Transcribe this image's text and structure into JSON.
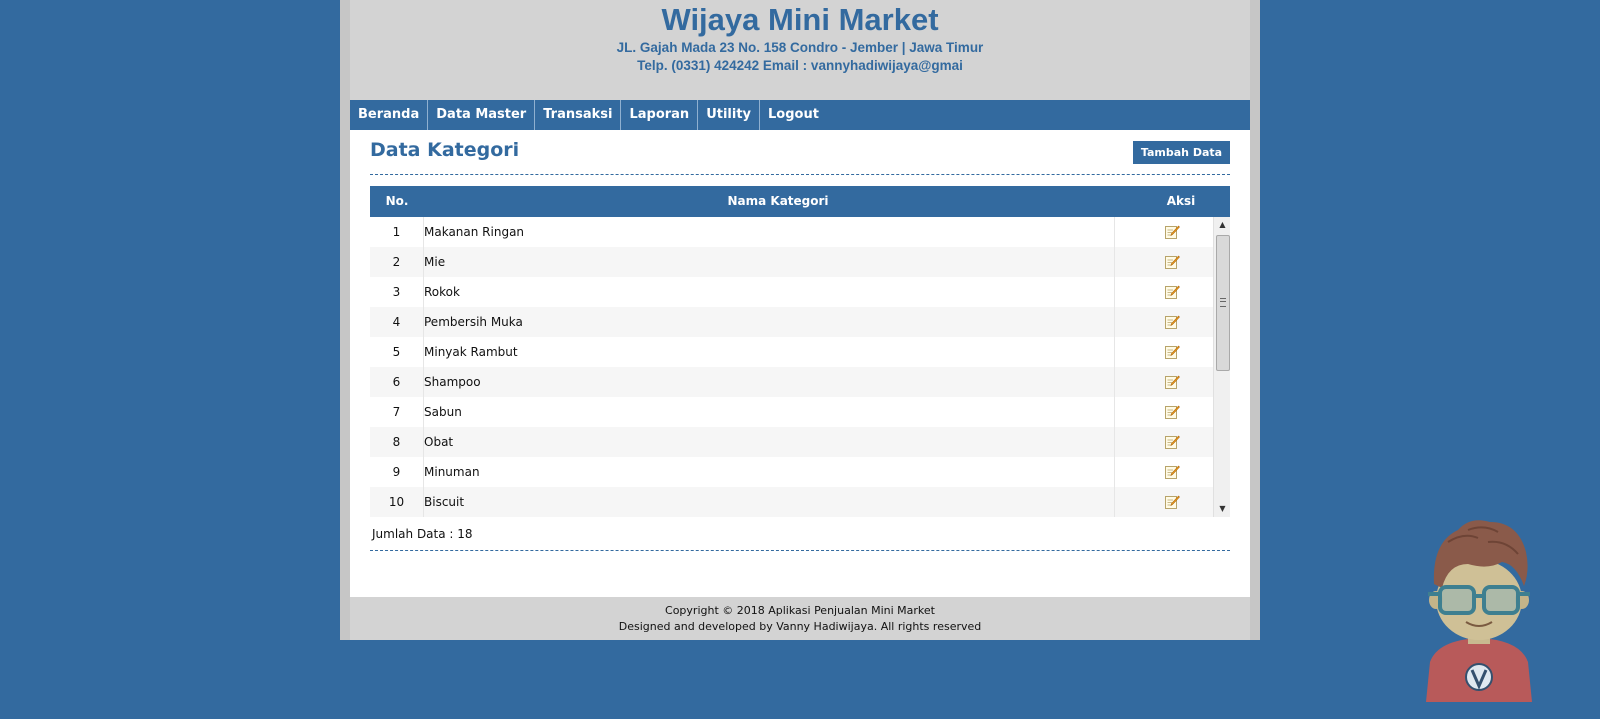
{
  "header": {
    "title": "Wijaya Mini Market",
    "address": "JL. Gajah Mada 23 No. 158 Condro - Jember | Jawa Timur",
    "contact": "Telp. (0331) 424242 Email : vannyhadiwijaya@gmai"
  },
  "nav": {
    "items": [
      {
        "label": "Beranda"
      },
      {
        "label": "Data Master"
      },
      {
        "label": "Transaksi"
      },
      {
        "label": "Laporan"
      },
      {
        "label": "Utility"
      },
      {
        "label": "Logout"
      }
    ]
  },
  "page": {
    "title": "Data Kategori",
    "add_button": "Tambah Data"
  },
  "table": {
    "headers": {
      "no": "No.",
      "name": "Nama Kategori",
      "action": "Aksi"
    },
    "rows": [
      {
        "no": "1",
        "name": "Makanan Ringan"
      },
      {
        "no": "2",
        "name": "Mie"
      },
      {
        "no": "3",
        "name": "Rokok"
      },
      {
        "no": "4",
        "name": "Pembersih Muka"
      },
      {
        "no": "5",
        "name": "Minyak Rambut"
      },
      {
        "no": "6",
        "name": "Shampoo"
      },
      {
        "no": "7",
        "name": "Sabun"
      },
      {
        "no": "8",
        "name": "Obat"
      },
      {
        "no": "9",
        "name": "Minuman"
      },
      {
        "no": "10",
        "name": "Biscuit"
      }
    ],
    "row_action_icon": "edit-icon"
  },
  "summary": {
    "label": "Jumlah Data : 18"
  },
  "footer": {
    "line1": "Copyright © 2018 Aplikasi Penjualan Mini Market",
    "line2": "Designed and developed by Vanny Hadiwijaya. All rights reserved"
  },
  "colors": {
    "background": "#336a9f",
    "accent": "#336a9f",
    "panel": "#d3d3d3"
  }
}
